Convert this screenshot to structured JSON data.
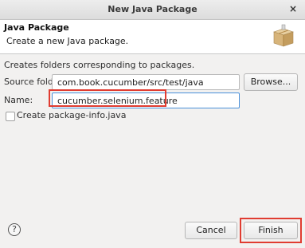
{
  "window": {
    "title": "New Java Package",
    "close_glyph": "×"
  },
  "banner": {
    "title": "Java Package",
    "description": "Create a new Java package.",
    "icon": "package-icon"
  },
  "form": {
    "info": "Creates folders corresponding to packages.",
    "source_folder_label": "Source folder:",
    "source_folder_value": "com.book.cucumber/src/test/java",
    "browse_label": "Browse...",
    "name_label": "Name:",
    "name_value": "cucumber.selenium.feature",
    "package_info_label": "Create package-info.java",
    "package_info_checked": false
  },
  "footer": {
    "help_glyph": "?",
    "cancel_label": "Cancel",
    "finish_label": "Finish"
  },
  "colors": {
    "highlight": "#e03c31",
    "focus": "#4a90d9"
  }
}
